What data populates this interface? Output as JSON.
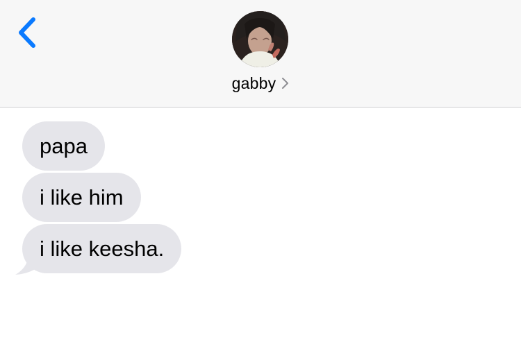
{
  "header": {
    "contact_name": "gabby",
    "avatar_description": "contact photo",
    "accent_color": "#0a7aff"
  },
  "icons": {
    "back": "chevron-left-icon",
    "contact_details": "chevron-right-icon"
  },
  "messages": [
    {
      "text": "papa",
      "direction": "incoming"
    },
    {
      "text": "i like him",
      "direction": "incoming"
    },
    {
      "text": "i like keesha.",
      "direction": "incoming"
    }
  ],
  "colors": {
    "header_background": "#f7f7f7",
    "incoming_bubble": "#e5e5ea",
    "text": "#000000"
  }
}
